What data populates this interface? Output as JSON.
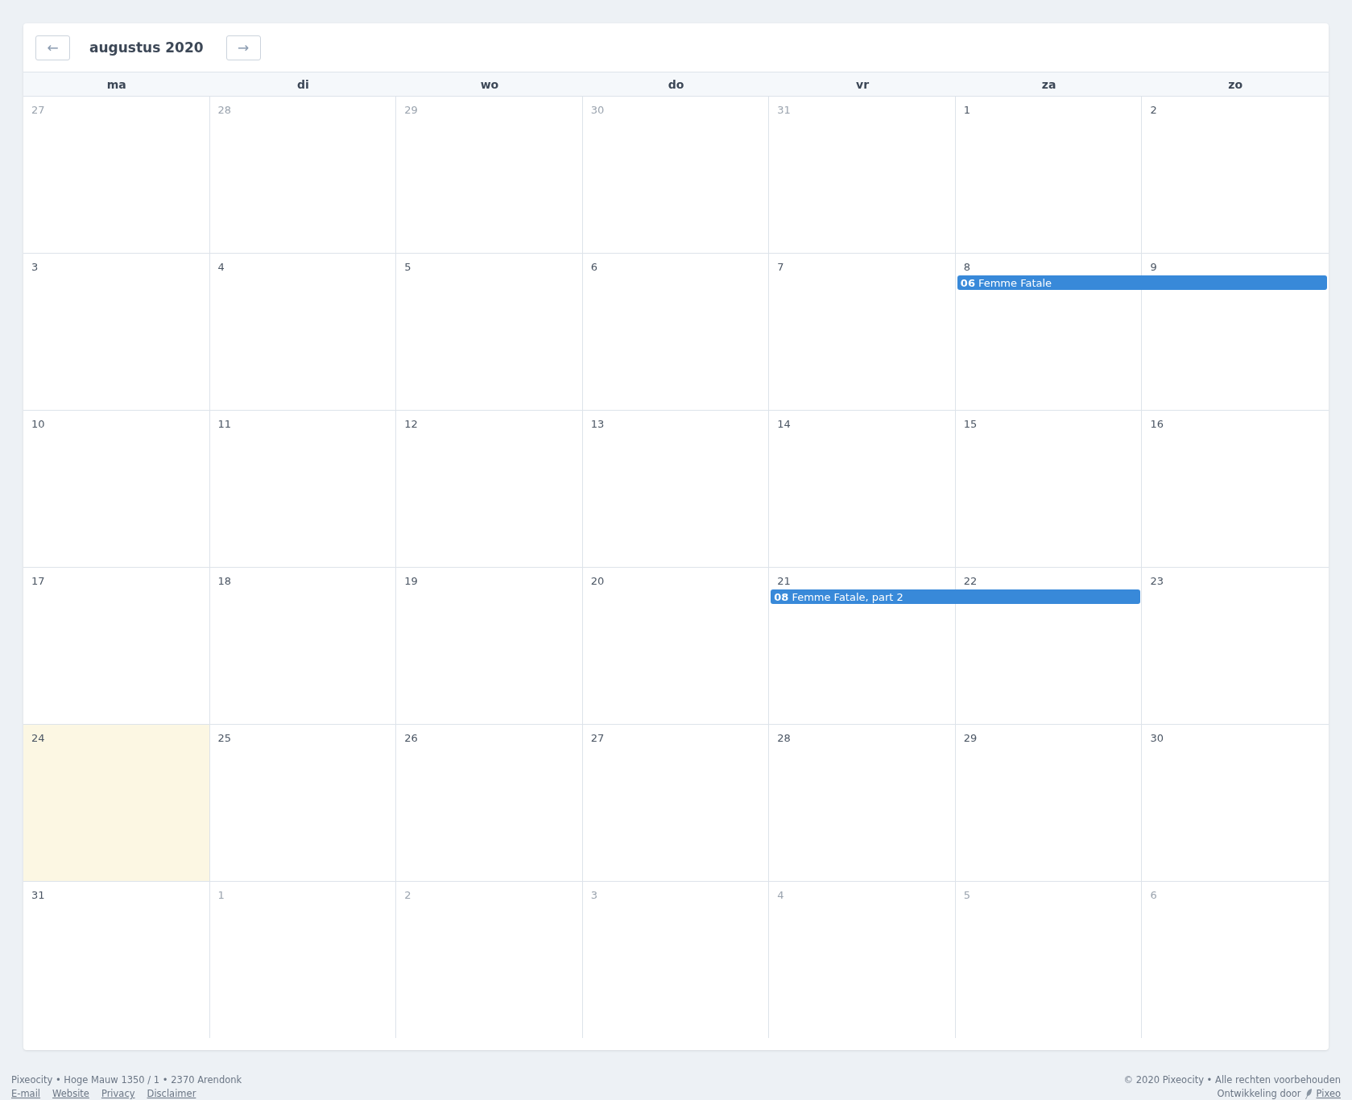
{
  "calendar": {
    "title": "augustus 2020",
    "prev_button": "←",
    "next_button": "→",
    "weekdays": [
      "ma",
      "di",
      "wo",
      "do",
      "vr",
      "za",
      "zo"
    ],
    "weeks": [
      {
        "days": [
          {
            "number": "27",
            "muted": true,
            "today": false
          },
          {
            "number": "28",
            "muted": true,
            "today": false
          },
          {
            "number": "29",
            "muted": true,
            "today": false
          },
          {
            "number": "30",
            "muted": true,
            "today": false
          },
          {
            "number": "31",
            "muted": true,
            "today": false
          },
          {
            "number": "1",
            "muted": false,
            "today": false
          },
          {
            "number": "2",
            "muted": false,
            "today": false
          }
        ]
      },
      {
        "days": [
          {
            "number": "3",
            "muted": false,
            "today": false
          },
          {
            "number": "4",
            "muted": false,
            "today": false
          },
          {
            "number": "5",
            "muted": false,
            "today": false
          },
          {
            "number": "6",
            "muted": false,
            "today": false
          },
          {
            "number": "7",
            "muted": false,
            "today": false
          },
          {
            "number": "8",
            "muted": false,
            "today": false,
            "events": [
              {
                "time": "06",
                "title": "Femme Fatale",
                "spans_next_day": true
              }
            ]
          },
          {
            "number": "9",
            "muted": false,
            "today": false
          }
        ]
      },
      {
        "days": [
          {
            "number": "10",
            "muted": false,
            "today": false
          },
          {
            "number": "11",
            "muted": false,
            "today": false
          },
          {
            "number": "12",
            "muted": false,
            "today": false
          },
          {
            "number": "13",
            "muted": false,
            "today": false
          },
          {
            "number": "14",
            "muted": false,
            "today": false
          },
          {
            "number": "15",
            "muted": false,
            "today": false
          },
          {
            "number": "16",
            "muted": false,
            "today": false
          }
        ]
      },
      {
        "days": [
          {
            "number": "17",
            "muted": false,
            "today": false
          },
          {
            "number": "18",
            "muted": false,
            "today": false
          },
          {
            "number": "19",
            "muted": false,
            "today": false
          },
          {
            "number": "20",
            "muted": false,
            "today": false
          },
          {
            "number": "21",
            "muted": false,
            "today": false,
            "events": [
              {
                "time": "08",
                "title": "Femme Fatale, part 2",
                "spans_next_day": true
              }
            ]
          },
          {
            "number": "22",
            "muted": false,
            "today": false
          },
          {
            "number": "23",
            "muted": false,
            "today": false
          }
        ]
      },
      {
        "days": [
          {
            "number": "24",
            "muted": false,
            "today": true
          },
          {
            "number": "25",
            "muted": false,
            "today": false
          },
          {
            "number": "26",
            "muted": false,
            "today": false
          },
          {
            "number": "27",
            "muted": false,
            "today": false
          },
          {
            "number": "28",
            "muted": false,
            "today": false
          },
          {
            "number": "29",
            "muted": false,
            "today": false
          },
          {
            "number": "30",
            "muted": false,
            "today": false
          }
        ]
      },
      {
        "days": [
          {
            "number": "31",
            "muted": false,
            "today": false
          },
          {
            "number": "1",
            "muted": true,
            "today": false
          },
          {
            "number": "2",
            "muted": true,
            "today": false
          },
          {
            "number": "3",
            "muted": true,
            "today": false
          },
          {
            "number": "4",
            "muted": true,
            "today": false
          },
          {
            "number": "5",
            "muted": true,
            "today": false
          },
          {
            "number": "6",
            "muted": true,
            "today": false
          }
        ]
      }
    ]
  },
  "footer": {
    "address": "Pixeocity • Hoge Mauw 1350 / 1 • 2370 Arendonk",
    "links": [
      "E-mail",
      "Website",
      "Privacy",
      "Disclaimer"
    ],
    "copyright": "© 2020 Pixeocity • Alle rechten voorbehouden",
    "credit_label": "Ontwikkeling door",
    "credit_link": "Pixeo"
  }
}
